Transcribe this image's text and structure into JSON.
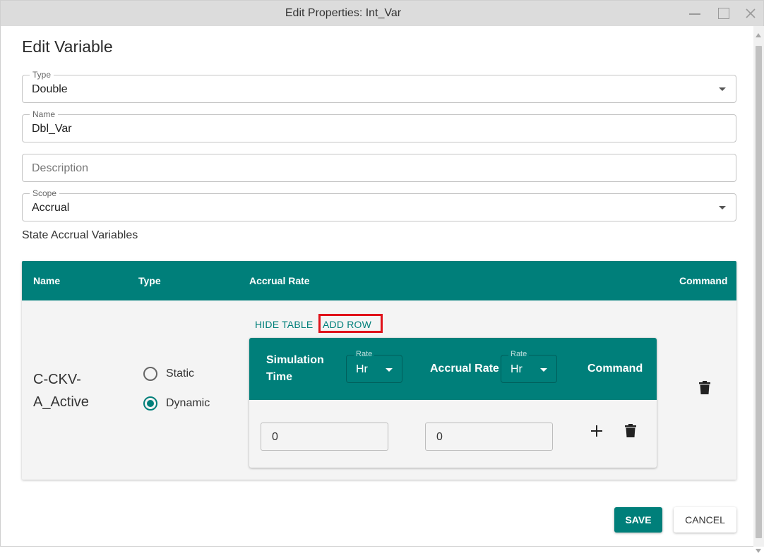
{
  "window": {
    "title": "Edit Properties: Int_Var",
    "controls": [
      "minimize-icon",
      "maximize-icon",
      "close-icon"
    ]
  },
  "heading": "Edit Variable",
  "fields": {
    "type": {
      "label": "Type",
      "value": "Double"
    },
    "name": {
      "label": "Name",
      "value": "Dbl_Var"
    },
    "description": {
      "placeholder": "Description",
      "value": ""
    },
    "scope": {
      "label": "Scope",
      "value": "Accrual"
    }
  },
  "section_label": "State Accrual Variables",
  "table": {
    "columns": [
      "Name",
      "Type",
      "Accrual Rate",
      "Command"
    ],
    "row": {
      "name": "C-CKV-A_Active",
      "type_options": [
        {
          "label": "Static",
          "checked": false
        },
        {
          "label": "Dynamic",
          "checked": true
        }
      ],
      "hide_table_label": "HIDE TABLE",
      "add_row_label": "ADD ROW",
      "delete_icon": "trash-icon"
    },
    "inner_table": {
      "col_sim_time": "Simulation Time",
      "sim_time_rate": {
        "label": "Rate",
        "value": "Hr"
      },
      "col_accrual_rate": "Accrual Rate",
      "accrual_rate_rate": {
        "label": "Rate",
        "value": "Hr"
      },
      "col_command": "Command",
      "rows": [
        {
          "simulation_time": "0",
          "accrual_rate": "0",
          "add_icon": "plus-icon",
          "delete_icon": "trash-icon"
        }
      ]
    }
  },
  "actions": {
    "save_label": "SAVE",
    "cancel_label": "CANCEL"
  },
  "colors": {
    "accent": "#007f7a",
    "highlight": "#e0121a"
  }
}
